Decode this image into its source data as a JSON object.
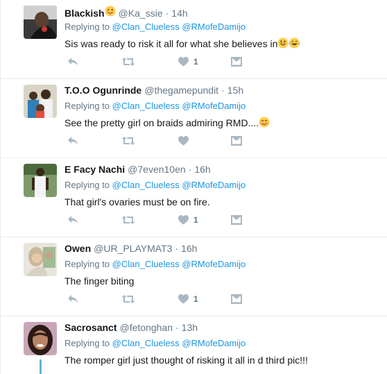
{
  "tweets": [
    {
      "fullname": "Blackish",
      "name_emoji": "tongue-out-emoji",
      "username": "@Ka_ssie",
      "time": "14h",
      "replying_label": "Replying to",
      "mention1": "@Clan_Clueless",
      "mention2": "@RMofeDamijo",
      "text": "Sis was ready to risk it all for what  she believes in",
      "text_emojis": [
        "grinning-emoji",
        "tears-of-joy-emoji"
      ],
      "likes": "1"
    },
    {
      "fullname": "T.O.O Ogunrinde",
      "username": "@thegamepundit",
      "time": "15h",
      "replying_label": "Replying to",
      "mention1": "@Clan_Clueless",
      "mention2": "@RMofeDamijo",
      "text": "See the pretty girl on braids admiring RMD....",
      "text_emojis": [
        "smiling-eyes-emoji"
      ],
      "likes": ""
    },
    {
      "fullname": "E Facy Nachi",
      "username": "@7even10en",
      "time": "16h",
      "replying_label": "Replying to",
      "mention1": "@Clan_Clueless",
      "mention2": "@RMofeDamijo",
      "text": "That girl's ovaries must be on fire.",
      "likes": "1"
    },
    {
      "fullname": "Owen",
      "username": "@UR_PLAYMAT3",
      "time": "16h",
      "replying_label": "Replying to",
      "mention1": "@Clan_Clueless",
      "mention2": "@RMofeDamijo",
      "text": "The finger biting",
      "likes": "1"
    },
    {
      "fullname": "Sacrosanct",
      "username": "@fetonghan",
      "time": "13h",
      "replying_label": "Replying to",
      "mention1": "@Clan_Clueless",
      "mention2": "@RMofeDamijo",
      "text": "The romper girl just thought of risking it all in d third pic!!!"
    }
  ],
  "colors": {
    "link": "#1b95e0",
    "muted": "#657786",
    "icon": "#aab8c2",
    "border": "#e6ecf0",
    "thread_line": "#66b2d3"
  },
  "icons": {
    "reply": "reply-icon",
    "retweet": "retweet-icon",
    "like": "heart-icon",
    "dm": "direct-message-icon"
  }
}
